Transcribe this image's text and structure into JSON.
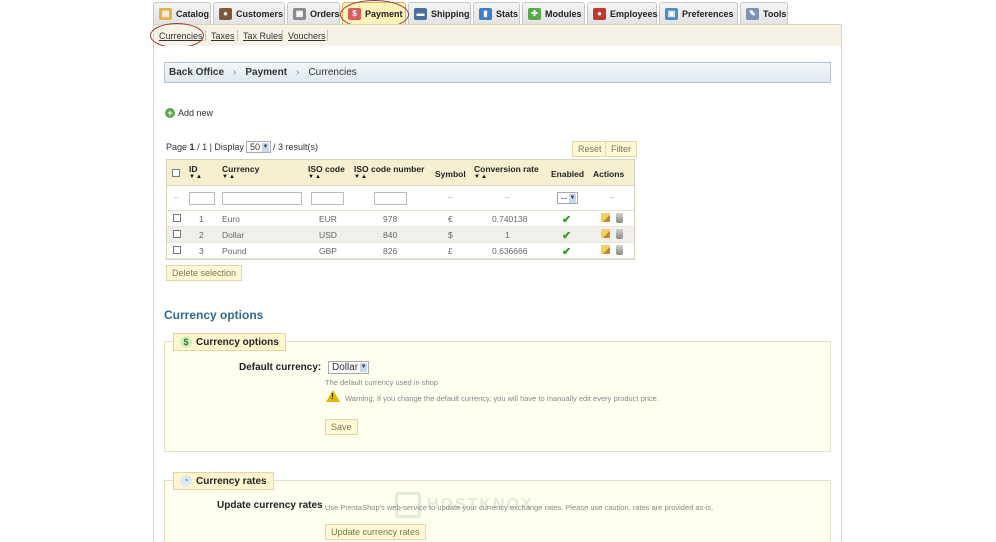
{
  "tabs": [
    {
      "label": "Catalog",
      "icon": "folder-icon",
      "color": "#e8b04a"
    },
    {
      "label": "Customers",
      "icon": "user-icon",
      "color": "#7a5a3a"
    },
    {
      "label": "Orders",
      "icon": "cart-icon",
      "color": "#8a8a8a"
    },
    {
      "label": "Payment",
      "icon": "payment-icon",
      "color": "#d95c5c",
      "active": true
    },
    {
      "label": "Shipping",
      "icon": "truck-icon",
      "color": "#4a6f9a"
    },
    {
      "label": "Stats",
      "icon": "bar-chart-icon",
      "color": "#3b7fcf"
    },
    {
      "label": "Modules",
      "icon": "puzzle-icon",
      "color": "#58a94a"
    },
    {
      "label": "Employees",
      "icon": "employee-icon",
      "color": "#c0392b"
    },
    {
      "label": "Preferences",
      "icon": "preferences-icon",
      "color": "#4c8cc4"
    },
    {
      "label": "Tools",
      "icon": "wrench-icon",
      "color": "#7b93b0"
    }
  ],
  "subtabs": [
    "Currencies",
    "Taxes",
    "Tax Rules",
    "Vouchers"
  ],
  "breadcrumb": {
    "root": "Back Office",
    "section": "Payment",
    "page": "Currencies"
  },
  "add_new": "Add new",
  "pager": {
    "prefix": "Page",
    "page": "1",
    "total": "/ 1 | Display",
    "per_page": "50",
    "suffix": "/ 3 result(s)"
  },
  "buttons": {
    "reset": "Reset",
    "filter": "Filter",
    "delete_selection": "Delete selection",
    "save": "Save",
    "update_rates": "Update currency rates"
  },
  "table": {
    "headers": {
      "id": "ID",
      "currency": "Currency",
      "iso_code": "ISO code",
      "iso_number": "ISO code number",
      "symbol": "Symbol",
      "conversion": "Conversion rate",
      "enabled": "Enabled",
      "actions": "Actions"
    },
    "sort_glyphs": "▼▲",
    "filter_dash": "--",
    "filter_enabled_value": "--",
    "rows": [
      {
        "id": "1",
        "name": "Euro",
        "iso": "EUR",
        "number": "978",
        "symbol": "€",
        "rate": "0.740138"
      },
      {
        "id": "2",
        "name": "Dollar",
        "iso": "USD",
        "number": "840",
        "symbol": "$",
        "rate": "1"
      },
      {
        "id": "3",
        "name": "Pound",
        "iso": "GBP",
        "number": "826",
        "symbol": "£",
        "rate": "0.636666"
      }
    ]
  },
  "options": {
    "heading": "Currency options",
    "legend": "Currency options",
    "default_label": "Default currency:",
    "default_value": "Dollar",
    "help": "The default currency used in shop",
    "warning": "Warning: If you change the default currency, you will have to manually edit every product price."
  },
  "rates": {
    "legend": "Currency rates",
    "label": "Update currency rates",
    "help": "Use PrestaShop's web-service to update your currency exchange rates. Please use caution, rates are provided as-is."
  },
  "watermark": "HOSTKNOX"
}
